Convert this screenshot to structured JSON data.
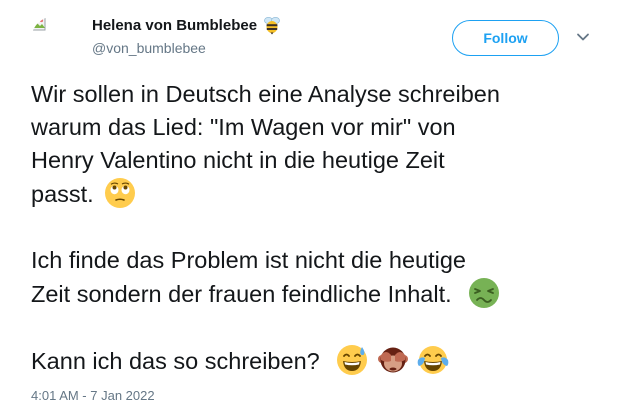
{
  "user": {
    "display_name": "Helena von Bumblebee",
    "handle": "@von_bumblebee",
    "name_badge_icon": "bee-icon",
    "avatar_icon": "broken-image-icon"
  },
  "follow_button": {
    "label": "Follow",
    "color": "#1da1f2"
  },
  "menu_icon": "chevron-down-icon",
  "tweet": {
    "paragraph_1": {
      "lines": [
        "Wir sollen in Deutsch eine Analyse schreiben",
        "warum das Lied: \"Im Wagen vor mir\" von",
        "Henry Valentino nicht in die heutige Zeit",
        "passt."
      ],
      "emoji": "face-with-rolling-eyes-icon"
    },
    "paragraph_2": {
      "lines": [
        "Ich finde das Problem ist nicht die heutige",
        "Zeit sondern der frauen feindliche Inhalt."
      ],
      "emoji": "nauseated-face-icon"
    },
    "paragraph_3": {
      "lines": [
        "Kann ich das so schreiben?"
      ],
      "emojis": [
        "grinning-face-with-sweat-icon",
        "see-no-evil-monkey-icon",
        "face-with-tears-of-joy-icon"
      ]
    }
  },
  "timestamp": "4:01 AM - 7 Jan 2022",
  "colors": {
    "text": "#14171a",
    "secondary_text": "#657786",
    "accent": "#1da1f2"
  }
}
